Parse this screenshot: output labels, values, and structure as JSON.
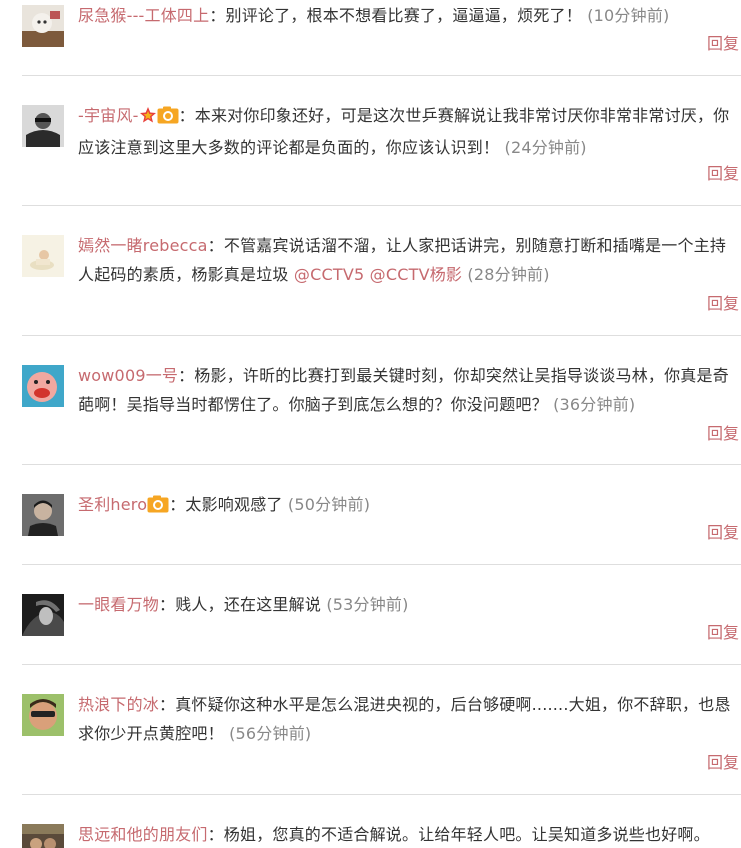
{
  "colors": {
    "accent": "#c66a6f",
    "time": "#888888",
    "text": "#333333",
    "divider": "#dedede"
  },
  "comments": [
    {
      "user": "尿急猴---工体四上",
      "text": "：别评论了，根本不想看比赛了，逼逼逼，烦死了！",
      "time": "(10分钟前)",
      "reply": "回复",
      "badges": []
    },
    {
      "user": "-宇宙风-",
      "text": "：本来对你印象还好，可是这次世乒赛解说让我非常讨厌你非常非常讨厌，你应该注意到这里大多数的评论都是负面的，你应该认识到！",
      "time": "(24分钟前)",
      "reply": "回复",
      "badges": [
        "star-badge-icon",
        "camera-badge-icon"
      ]
    },
    {
      "user": "嫣然一睹rebecca",
      "text": "：不管嘉宾说话溜不溜，让人家把话讲完，别随意打断和插嘴是一个主持人起码的素质，杨影真是垃圾",
      "mentions": [
        "@CCTV5",
        "@CCTV杨影"
      ],
      "time": "(28分钟前)",
      "reply": "回复",
      "badges": []
    },
    {
      "user": "wow009一号",
      "text": "：杨影，许昕的比赛打到最关键时刻，你却突然让吴指导谈谈马林，你真是奇葩啊！吴指导当时都愣住了。你脑子到底怎么想的？你没问题吧？",
      "time": "(36分钟前)",
      "reply": "回复",
      "badges": []
    },
    {
      "user": "圣利hero",
      "text": "：太影响观感了",
      "time": "(50分钟前)",
      "reply": "回复",
      "badges": [
        "camera-badge-icon"
      ]
    },
    {
      "user": "一眼看万物",
      "text": "：贱人，还在这里解说",
      "time": "(53分钟前)",
      "reply": "回复",
      "badges": []
    },
    {
      "user": "热浪下的冰",
      "text": "：真怀疑你这种水平是怎么混进央视的，后台够硬啊.......大姐，你不辞职，也恳求你少开点黄腔吧！",
      "time": "(56分钟前)",
      "reply": "回复",
      "badges": []
    },
    {
      "user": "思远和他的朋友们",
      "text": "：杨姐，您真的不适合解说。让给年轻人吧。让吴知道多说些也好啊。",
      "time": "",
      "reply": "",
      "badges": []
    }
  ]
}
